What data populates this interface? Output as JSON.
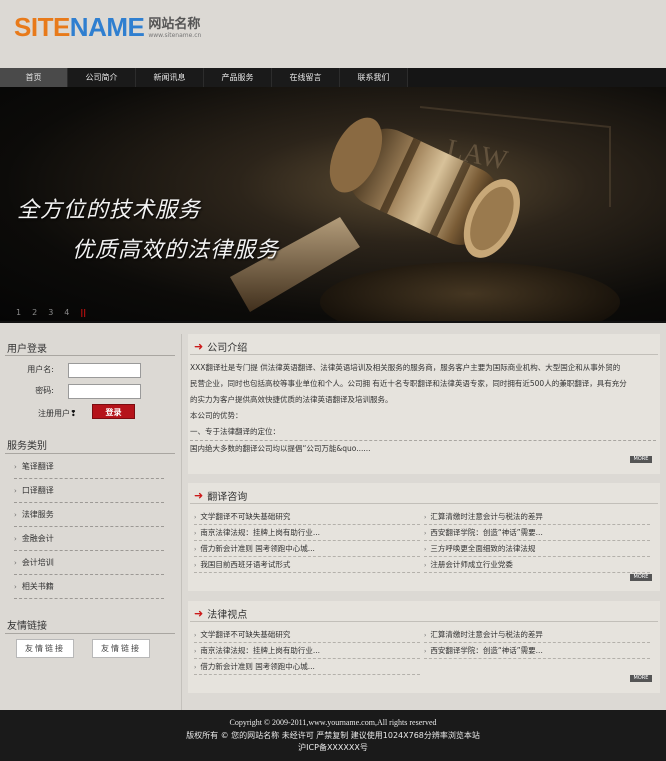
{
  "header": {
    "logo_main": "SITENAME",
    "logo_cn": "网站名称",
    "logo_url": "www.sitename.cn"
  },
  "nav": {
    "items": [
      "首页",
      "公司简介",
      "新闻讯息",
      "产品服务",
      "在线留言",
      "联系我们"
    ],
    "active_index": 0
  },
  "banner": {
    "slogan_1": "全方位的技术服务",
    "slogan_2": "优质高效的法律服务",
    "gavel_text": "LAW",
    "pager": [
      "1",
      "2",
      "3",
      "4",
      "||"
    ],
    "active_page": 4
  },
  "sidebar": {
    "login_title": "用户登录",
    "username_label": "用户名:",
    "password_label": "密码:",
    "username_value": "",
    "password_value": "",
    "register_label": "注册用户",
    "register_mark": "❢",
    "login_button": "登录",
    "service_title": "服务类别",
    "service_items": [
      "笔译翻译",
      "口译翻译",
      "法律服务",
      "金融会计",
      "会计培训",
      "相关书籍"
    ],
    "links_title": "友情链接",
    "friend_links": [
      "友情链接",
      "友情链接"
    ]
  },
  "main": {
    "more_label": "MORE",
    "company": {
      "title": "公司介绍",
      "lines": [
        "XXX翻译社是专门提 供法律英语翻译、法律英语培训及相关服务的服务商，服务客户主要为国际商业机构、大型国企和从事外贸的",
        "民营企业，同时也包括高校等事业单位和个人。公司拥 有近十名专职翻译和法律英语专家，同时拥有近500人的兼职翻译，具有充分",
        "的实力为客户提供高效快捷优质的法律英语翻译及培训服务。",
        "本公司的优势：",
        "一、专于法律翻译的定位：",
        "国内绝大多数的翻译公司均以提倡“公司万能&quo......"
      ]
    },
    "translation": {
      "title": "翻译咨询",
      "left": [
        "文学翻译不可缺失基础研究",
        "南京法律法规：挂牌上岗有助行业...",
        "借力新会计准则 国考领跑中心城...",
        "我国目前西班牙语考试形式"
      ],
      "right": [
        "汇算清缴时注意会计与税法的差异",
        "西安翻译学院：创造“神话”需要...",
        "三方呼唤更全面细致的法律法规",
        "注册会计师成立行业党委"
      ]
    },
    "law": {
      "title": "法律视点",
      "left": [
        "文学翻译不可缺失基础研究",
        "南京法律法规：挂牌上岗有助行业...",
        "借力新会计准则 国考领跑中心城..."
      ],
      "right": [
        "汇算清缴时注意会计与税法的差异",
        "西安翻译学院：创造“神话”需要..."
      ]
    }
  },
  "footer": {
    "copyright": "Copyright © 2009-2011,www.yourname.com,All rights reserved",
    "rights_line": "版权所有 © 您的网站名称 未经许可 严禁复制 建议使用1024X768分辨率浏览本站",
    "icp": "沪ICP备XXXXXX号"
  }
}
